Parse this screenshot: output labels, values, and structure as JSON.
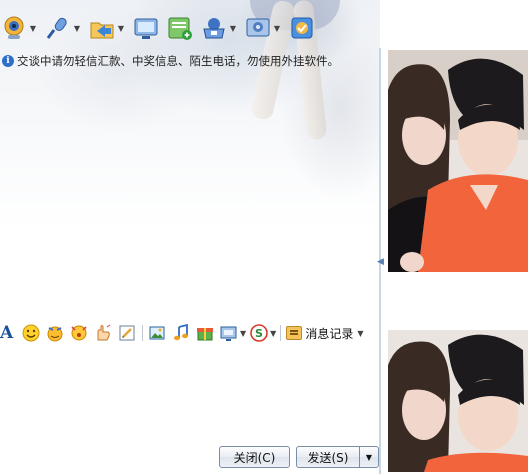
{
  "toolbar": {
    "items": [
      {
        "icon": "webcam-icon",
        "has_menu": true
      },
      {
        "icon": "microphone-icon",
        "has_menu": true
      },
      {
        "icon": "send-file-icon",
        "has_menu": true
      },
      {
        "icon": "screenshot-icon",
        "has_menu": false
      },
      {
        "icon": "add-app-icon",
        "has_menu": false
      },
      {
        "icon": "remote-assist-icon",
        "has_menu": true
      },
      {
        "icon": "settings-icon",
        "has_menu": true
      },
      {
        "icon": "app-box-icon",
        "has_menu": false
      }
    ]
  },
  "notice": {
    "icon": "info-icon",
    "text": "交谈中请勿轻信汇款、中奖信息、陌生电话，勿使用外挂软件。"
  },
  "format_toolbar": {
    "font_icon": "A",
    "icons": [
      "emoji-icon",
      "magic-emoji-icon",
      "shake-icon",
      "poke-icon",
      "doodle-icon",
      "image-icon",
      "music-icon",
      "gift-icon",
      "screen-capture-icon",
      "sogou-input-icon"
    ],
    "history_label": "消息记录"
  },
  "buttons": {
    "close_label": "关闭(C)",
    "send_label": "发送(S)"
  },
  "colors": {
    "accent": "#2f6ec9",
    "divider": "#c8d6e8",
    "button_border": "#7a8ea8"
  }
}
